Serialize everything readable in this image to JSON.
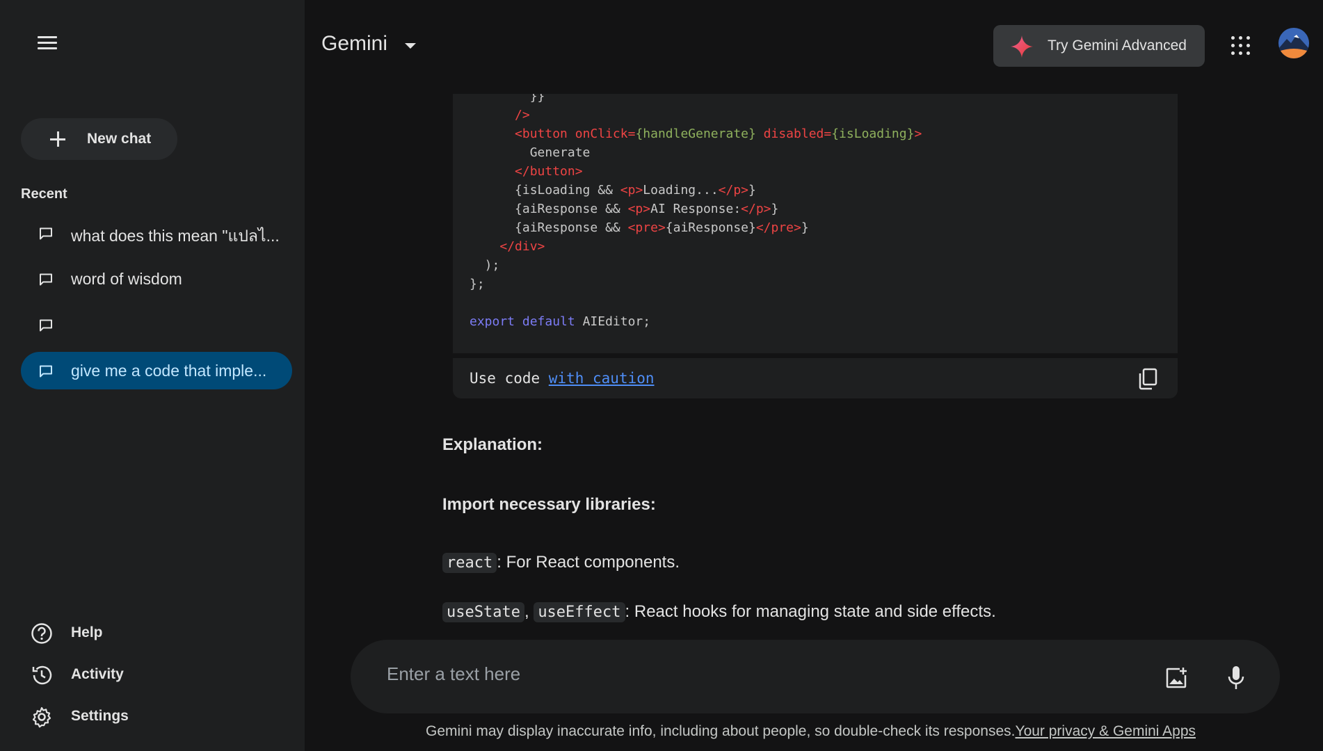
{
  "header": {
    "brand": "Gemini",
    "try_advanced": "Try Gemini Advanced"
  },
  "sidebar": {
    "new_chat": "New chat",
    "recent_title": "Recent",
    "recent": [
      {
        "label": "what does this mean \"แปลไ...",
        "active": false
      },
      {
        "label": "word of wisdom",
        "active": false
      },
      {
        "label": "",
        "active": false
      },
      {
        "label": "give me a code that imple...",
        "active": true
      }
    ],
    "bottom": {
      "help": "Help",
      "activity": "Activity",
      "settings": "Settings"
    }
  },
  "code": {
    "lines": [
      "        }}",
      "      />",
      "      <button onClick={handleGenerate} disabled={isLoading}>",
      "        Generate",
      "      </button>",
      "      {isLoading && <p>Loading...</p>}",
      "      {aiResponse && <p>AI Response:</p>}",
      "      {aiResponse && <pre>{aiResponse}</pre>}",
      "    </div>",
      "  );",
      "};",
      "",
      "export default AIEditor;"
    ],
    "footer_prefix": "Use code ",
    "footer_link": "with caution"
  },
  "explanation": {
    "heading": "Explanation:",
    "subheading": "Import necessary libraries:",
    "item1_code": "react",
    "item1_text": ": For React components.",
    "item2_code1": "useState",
    "item2_sep": ", ",
    "item2_code2": "useEffect",
    "item2_text": ": React hooks for managing state and side effects."
  },
  "input": {
    "placeholder": "Enter a text here"
  },
  "disclaimer": {
    "text": "Gemini may display inaccurate info, including about people, so double-check its responses.",
    "link": "Your privacy & Gemini Apps"
  },
  "colors": {
    "background": "#131314",
    "sidebar": "#1e1f20",
    "active_item": "#004a77",
    "link": "#4f8ef7"
  }
}
